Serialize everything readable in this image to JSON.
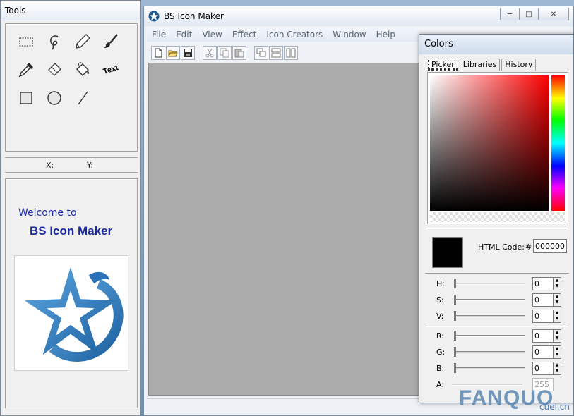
{
  "tools_window": {
    "title": "Tools",
    "tools": [
      {
        "name": "select-rect-tool",
        "icon": "marquee-icon"
      },
      {
        "name": "lasso-tool",
        "icon": "lasso-icon"
      },
      {
        "name": "pencil-tool",
        "icon": "pencil-icon"
      },
      {
        "name": "brush-tool",
        "icon": "brush-icon"
      },
      {
        "name": "eyedropper-tool",
        "icon": "eyedropper-icon"
      },
      {
        "name": "eraser-tool",
        "icon": "eraser-icon"
      },
      {
        "name": "fill-tool",
        "icon": "paint-bucket-icon"
      },
      {
        "name": "text-tool",
        "icon": "text-icon",
        "label": "Text"
      },
      {
        "name": "rectangle-tool",
        "icon": "square-icon"
      },
      {
        "name": "ellipse-tool",
        "icon": "circle-icon"
      },
      {
        "name": "line-tool",
        "icon": "line-icon"
      }
    ],
    "x_label": "X:",
    "y_label": "Y:",
    "welcome_line1": "Welcome to",
    "welcome_line2": "BS Icon Maker"
  },
  "main_window": {
    "title": "BS Icon Maker",
    "menu": [
      "File",
      "Edit",
      "View",
      "Effect",
      "Icon Creators",
      "Window",
      "Help"
    ],
    "toolbar_groups": [
      [
        "new-icon",
        "open-icon",
        "save-icon"
      ],
      [
        "cut-icon",
        "copy-icon",
        "paste-icon"
      ],
      [
        "cascade-icon",
        "tile-horizontal-icon",
        "tile-vertical-icon"
      ]
    ]
  },
  "colors_window": {
    "title": "Colors",
    "tabs": [
      "Picker",
      "Libraries",
      "History"
    ],
    "active_tab": "Picker",
    "html_code_label": "HTML Code:",
    "hash": "#",
    "html_code_value": "000000",
    "hsv": [
      {
        "label": "H:",
        "value": "0"
      },
      {
        "label": "S:",
        "value": "0"
      },
      {
        "label": "V:",
        "value": "0"
      }
    ],
    "rgb": [
      {
        "label": "R:",
        "value": "0"
      },
      {
        "label": "G:",
        "value": "0"
      },
      {
        "label": "B:",
        "value": "0"
      }
    ],
    "alpha": {
      "label": "A:",
      "value": "255"
    },
    "current_color": "#000000"
  },
  "watermark": {
    "text": "FANQUO",
    "sub": "cuel.cn"
  }
}
